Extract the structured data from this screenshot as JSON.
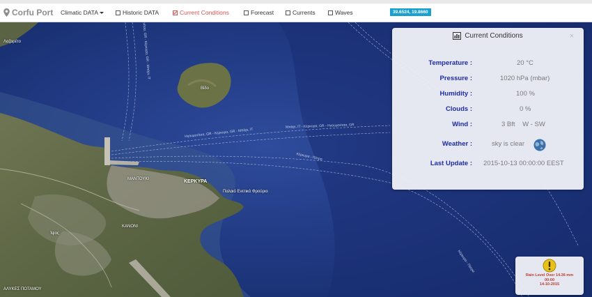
{
  "brand": {
    "name": "Corfu Port",
    "icon": "map-pin-icon"
  },
  "nav": {
    "climatic": "Climatic DATA",
    "historic": "Historic DATA",
    "current": "Current Conditions",
    "forecast": "Forecast",
    "currents": "Currents",
    "waves": "Waves",
    "active_item": "Current Conditions"
  },
  "coords": "39.6524, 19.8660",
  "map": {
    "labels": {
      "lazaretto": "Λαζαρέτο",
      "kerkyra": "ΚΕΡΚΥΡΑ",
      "mantouki": "ΜΑΝΤΟΥΚΙ",
      "old_fortress": "Παλαιό Ενετικό Φρούριο",
      "vido": "Βίδο",
      "ipsos": "Ίψος",
      "kanoni": "ΚΑΝΟΝΙ",
      "bottom_left": "ΑΛΥΚΕΣ ΠΟΤΑΜΟΥ"
    },
    "routes": {
      "r1": "Ηγουμενίτσα, GR - Κέρκυρα, GR - Μπάρι, IT",
      "r2": "Μπάρι, IT - Κέρκυρα, GR - Ηγουμενίτσα, GR",
      "r3": "Κέρκυρα - Πάτρα",
      "r4": "Ηγουμενίτσα, GR - Κέρκυρα, GR - Μπάρι, IT",
      "r5": "Κέρκυρα - Πάτρα"
    }
  },
  "panel": {
    "title": "Current Conditions",
    "close": "×",
    "rows": {
      "temperature": {
        "label": "Temperature :",
        "value": "20 °C"
      },
      "pressure": {
        "label": "Pressure :",
        "value": "1020 hPa (mbar)"
      },
      "humidity": {
        "label": "Humidity :",
        "value": "100 %"
      },
      "clouds": {
        "label": "Clouds :",
        "value": "0 %"
      },
      "wind": {
        "label": "Wind :",
        "value": "3 Bft    W - SW"
      },
      "weather": {
        "label": "Weather :",
        "value": "sky is clear"
      },
      "last_update": {
        "label": "Last Update :",
        "value": "2015-10-13 00:00:00 EEST"
      }
    },
    "weather_icon": "globe-icon"
  },
  "rain": {
    "line1": "Rain Level Over 14.36 mm",
    "line2": "00:00",
    "line3": "14-10-2015",
    "icon": "warning-icon"
  },
  "colors": {
    "active": "#d9534f",
    "label_blue": "#1e2aa8",
    "coords_bg": "#1aa0d0",
    "sea_deep": "#13214a",
    "rain_text": "#c0392b"
  }
}
